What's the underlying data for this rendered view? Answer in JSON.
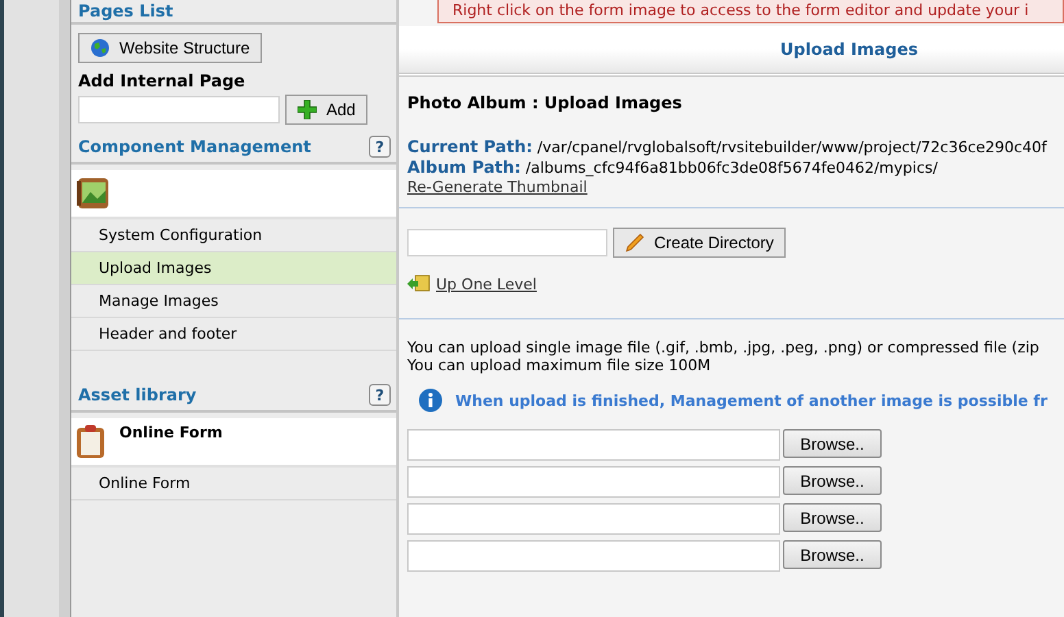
{
  "sidebar": {
    "pages_list": {
      "title": "Pages List",
      "website_structure_button": "Website Structure",
      "add_internal_page": {
        "label": "Add Internal Page",
        "button": "Add"
      }
    },
    "component_management": {
      "title": "Component Management",
      "help": "?",
      "items": [
        {
          "label": "System Configuration",
          "selected": false
        },
        {
          "label": "Upload Images",
          "selected": true
        },
        {
          "label": "Manage Images",
          "selected": false
        },
        {
          "label": "Header and footer",
          "selected": false
        }
      ]
    },
    "asset_library": {
      "title": "Asset library",
      "help": "?",
      "component": "Online Form",
      "items": [
        {
          "label": "Online Form",
          "selected": false
        }
      ]
    }
  },
  "main": {
    "notice": "Right click on the form image to access to the form editor and update your i",
    "page_title": "Upload Images",
    "heading": "Photo Album : Upload Images",
    "current_path": {
      "label": "Current Path:",
      "value": "/var/cpanel/rvglobalsoft/rvsitebuilder/www/project/72c36ce290c40f"
    },
    "album_path": {
      "label": "Album Path:",
      "value": "/albums_cfc94f6a81bb06fc3de08f5674fe0462/mypics/"
    },
    "regenerate_link": "Re-Generate Thumbnail",
    "create_directory_button": "Create Directory",
    "up_one_level_link": "Up One Level",
    "upload_info": [
      "You can upload single image file (.gif, .bmb, .jpg, .peg, .png) or compressed file (zip",
      "You can upload maximum file size 100M"
    ],
    "finish_note": "When upload is finished, Management of another image is possible fr",
    "file_rows": [
      {
        "button": "Browse.."
      },
      {
        "button": "Browse.."
      },
      {
        "button": "Browse.."
      },
      {
        "button": "Browse.."
      }
    ]
  }
}
